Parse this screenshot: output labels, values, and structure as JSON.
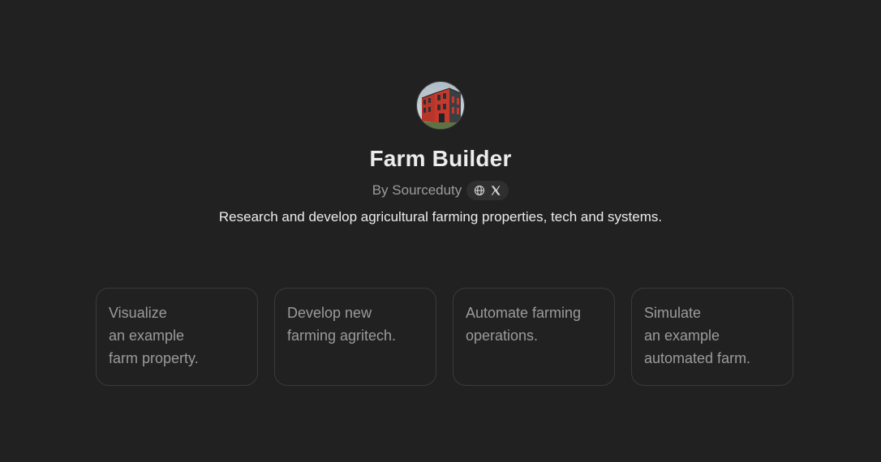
{
  "gpt": {
    "name": "Farm Builder",
    "author_prefix": "By",
    "author": "Sourceduty",
    "description": "Research and develop agricultural farming properties, tech and systems.",
    "avatar_icon": "modern-barn-building-image",
    "social": {
      "website_icon": "globe-icon",
      "x_icon": "x-logo-icon"
    }
  },
  "conversation_starters": [
    {
      "text": "Visualize\nan example\nfarm property."
    },
    {
      "text": "Develop new\nfarming agritech."
    },
    {
      "text": "Automate farming\noperations."
    },
    {
      "text": "Simulate\nan example\nautomated farm."
    }
  ],
  "colors": {
    "background": "#212121",
    "text_primary": "#ececec",
    "text_secondary": "#9b9b9b",
    "card_border": "#3a3a3a",
    "pill_background": "#2f2f2f",
    "barn_red": "#c8392b"
  }
}
